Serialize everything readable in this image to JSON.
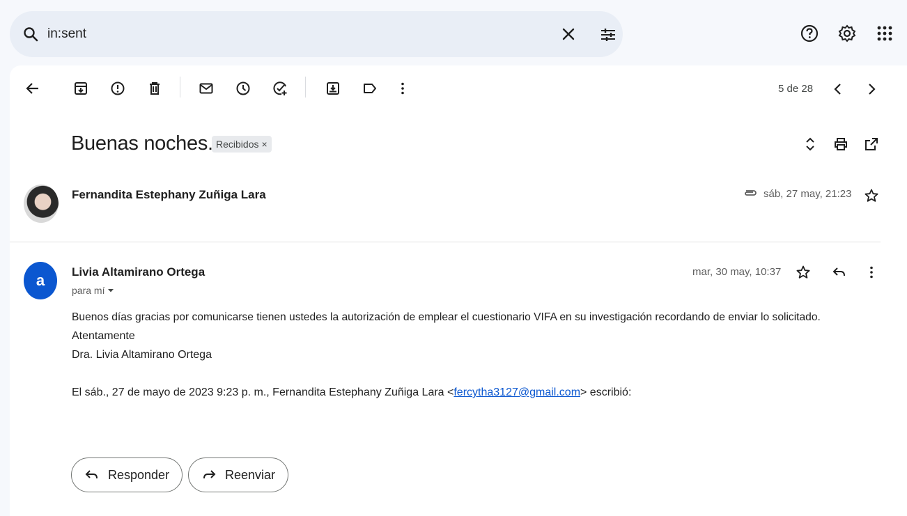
{
  "search": {
    "query": "in:sent"
  },
  "toolbar": {
    "pager": "5 de 28"
  },
  "thread": {
    "subject": "Buenas noches.",
    "label": "Recibidos",
    "label_remove": "×"
  },
  "messages": [
    {
      "sender": "Fernandita Estephany Zuñiga Lara",
      "date": "sáb, 27 may, 21:23"
    },
    {
      "avatar_letter": "a",
      "sender": "Livia Altamirano Ortega",
      "date": "mar, 30 may, 10:37",
      "recipient": "para mí",
      "body_line1": "Buenos días gracias por comunicarse tienen ustedes la autorización de emplear el cuestionario VIFA en su investigación recordando de enviar lo solicitado.",
      "body_line2": "Atentamente",
      "body_line3": "Dra. Livia Altamirano Ortega",
      "quote_prefix": "El sáb., 27 de mayo de 2023 9:23 p. m., Fernandita Estephany Zuñiga Lara <",
      "quote_email": "fercytha3127@gmail.com",
      "quote_suffix": "> escribió:"
    }
  ],
  "actions": {
    "reply": "Responder",
    "forward": "Reenviar"
  }
}
